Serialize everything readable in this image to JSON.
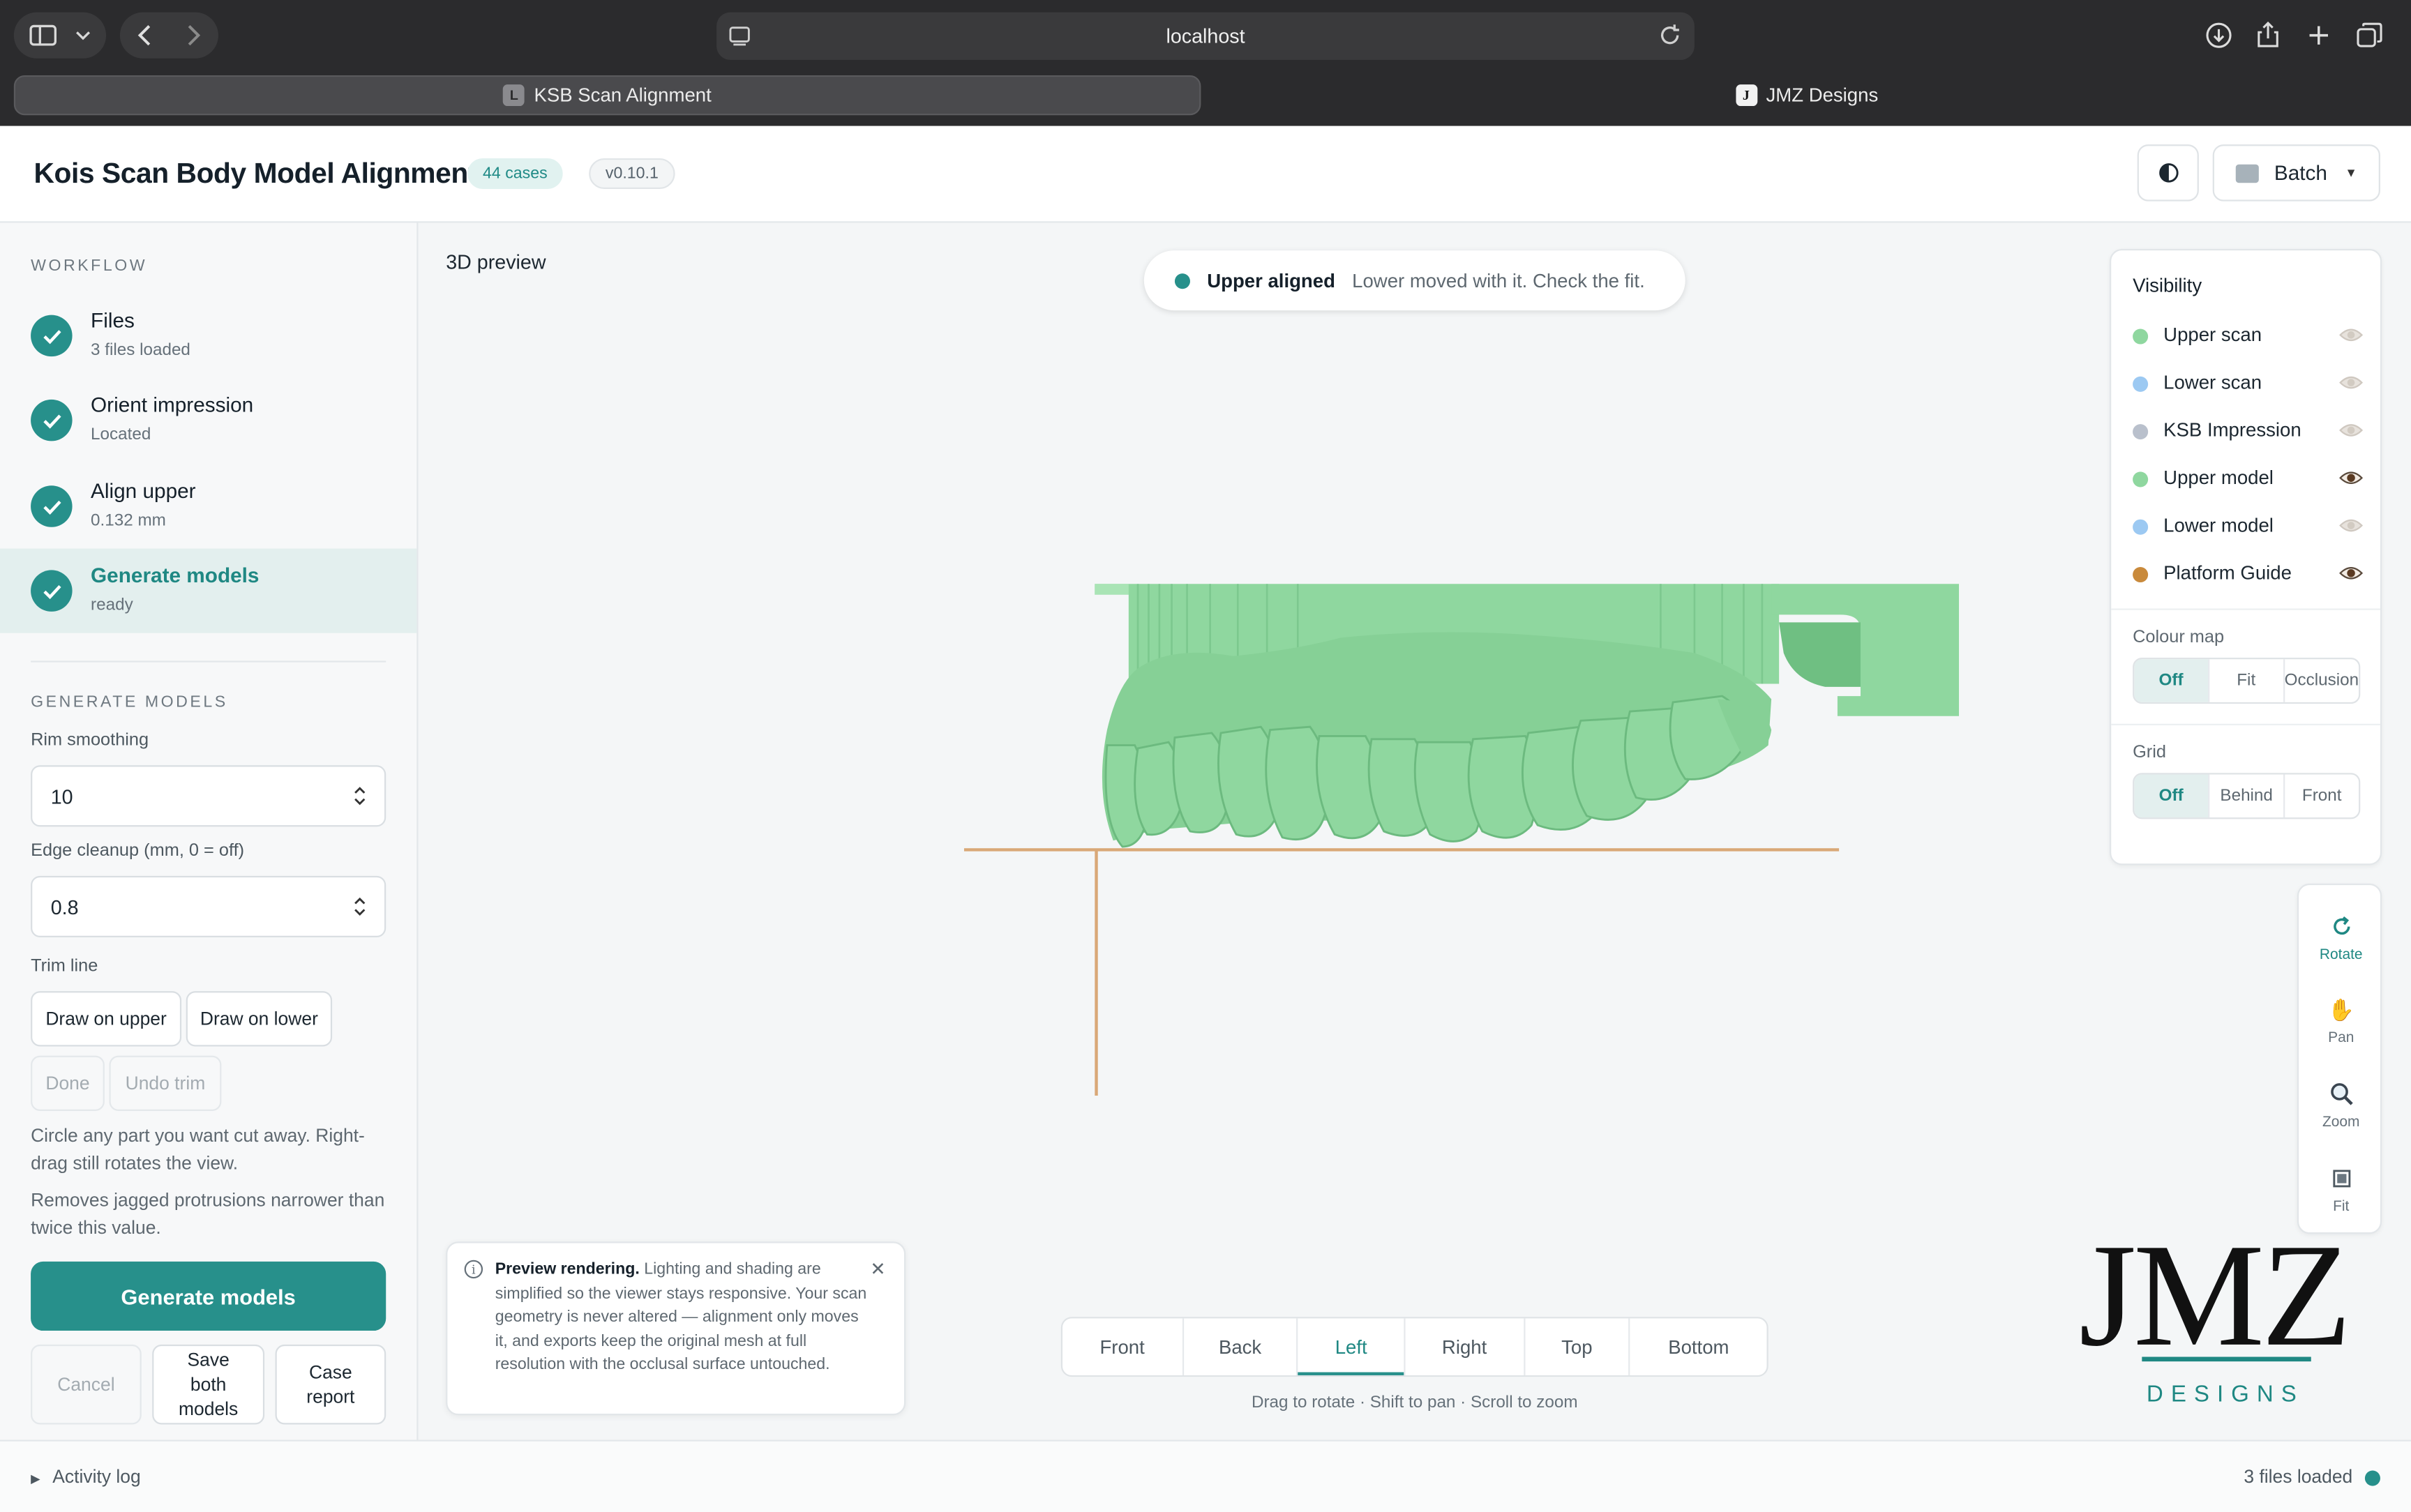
{
  "browser": {
    "url": "localhost",
    "tabs": [
      {
        "label": "KSB Scan Alignment",
        "favicon": "L"
      },
      {
        "label": "JMZ Designs",
        "favicon": "J"
      }
    ]
  },
  "header": {
    "title": "Kois Scan Body Model Alignment",
    "cases_badge": "44 cases",
    "version": "v0.10.1",
    "batch_label": "Batch"
  },
  "workflow": {
    "title": "WORKFLOW",
    "steps": [
      {
        "title": "Files",
        "subtitle": "3 files loaded",
        "done": true
      },
      {
        "title": "Orient impression",
        "subtitle": "Located",
        "done": true
      },
      {
        "title": "Align upper",
        "subtitle": "0.132 mm",
        "done": true
      },
      {
        "title": "Generate models",
        "subtitle": "ready",
        "done": true,
        "active": true
      }
    ]
  },
  "generate": {
    "title": "GENERATE MODELS",
    "rim_label": "Rim smoothing",
    "rim_value": "10",
    "edge_label": "Edge cleanup (mm, 0 = off)",
    "edge_value": "0.8",
    "trim_label": "Trim line",
    "draw_upper": "Draw on upper",
    "draw_lower": "Draw on lower",
    "done": "Done",
    "undo": "Undo trim",
    "help1": "Circle any part you want cut away. Right-drag still rotates the view.",
    "help2": "Removes jagged protrusions narrower than twice this value.",
    "primary": "Generate models",
    "cancel": "Cancel",
    "save_both": "Save both models",
    "case_report": "Case report"
  },
  "viewer": {
    "label": "3D preview",
    "status_bold": "Upper aligned",
    "status_msg": "Lower moved with it. Check the fit.",
    "model_color": "#8fd79f",
    "guide_color": "#d9a877"
  },
  "visibility": {
    "title": "Visibility",
    "items": [
      {
        "label": "Upper scan",
        "color": "#8fd79f",
        "visible": false
      },
      {
        "label": "Lower scan",
        "color": "#9cc9f2",
        "visible": false
      },
      {
        "label": "KSB Impression",
        "color": "#b9c0cc",
        "visible": false
      },
      {
        "label": "Upper model",
        "color": "#8fd79f",
        "visible": true
      },
      {
        "label": "Lower model",
        "color": "#9cc9f2",
        "visible": false
      },
      {
        "label": "Platform Guide",
        "color": "#c98a3c",
        "visible": true
      }
    ],
    "colour_map_label": "Colour map",
    "colour_map_options": [
      "Off",
      "Fit",
      "Occlusion"
    ],
    "colour_map_selected": "Off",
    "grid_label": "Grid",
    "grid_options": [
      "Off",
      "Behind",
      "Front"
    ],
    "grid_selected": "Off"
  },
  "tools": [
    {
      "label": "Rotate",
      "icon": "rotate-icon",
      "active": true
    },
    {
      "label": "Pan",
      "icon": "hand-icon",
      "active": false
    },
    {
      "label": "Zoom",
      "icon": "magnifier-icon",
      "active": false
    },
    {
      "label": "Fit",
      "icon": "fit-icon",
      "active": false
    }
  ],
  "note": {
    "bold": "Preview rendering.",
    "text": " Lighting and shading are simplified so the viewer stays responsive. Your scan geometry is never altered — alignment only moves it, and exports keep the original mesh at full resolution with the occlusal surface untouched."
  },
  "views": {
    "options": [
      "Front",
      "Back",
      "Left",
      "Right",
      "Top",
      "Bottom"
    ],
    "selected": "Left",
    "hint": "Drag to rotate · Shift to pan · Scroll to zoom"
  },
  "logo": {
    "text": "JMZ",
    "sub": "DESIGNS"
  },
  "footer": {
    "activity": "Activity log",
    "status": "3 files loaded"
  }
}
